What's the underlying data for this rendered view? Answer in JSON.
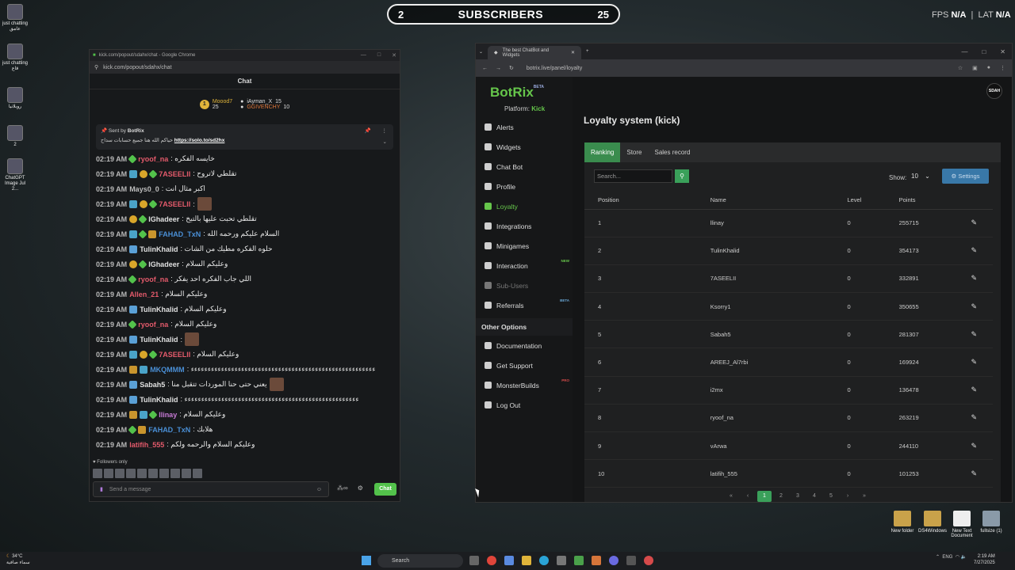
{
  "overlay": {
    "sub_left": "2",
    "sub_title": "SUBSCRIBERS",
    "sub_right": "25",
    "fps_label": "FPS",
    "fps_value": "N/A",
    "lat_label": "LAT",
    "lat_value": "N/A"
  },
  "desktop_left": [
    {
      "label": "just chatting عامق"
    },
    {
      "label": "just chatting قاع"
    },
    {
      "label": "روبلانيا"
    },
    {
      "label": "2"
    },
    {
      "label": "ChatGPT Image Jul 2..."
    }
  ],
  "desktop_right": [
    {
      "label": "New folder"
    },
    {
      "label": "DS4Windows"
    },
    {
      "label": "New Text Document"
    },
    {
      "label": "fullsize (1)"
    }
  ],
  "chat_window": {
    "title": "kick.com/popout/sdahx/chat - Google Chrome",
    "url": "kick.com/popout/sdahx/chat",
    "header": "Chat",
    "gifters": [
      {
        "name": "Moood7",
        "count": "25"
      },
      {
        "name": "iAyman_X",
        "count": "15"
      },
      {
        "name": "GGIVENCHY",
        "count": "10"
      }
    ],
    "pinned": {
      "sent_by": "Sent by",
      "bot": "BotRix",
      "text": "حياكم الله هنا جميع حسابات سداح",
      "link": "https://solo.to/sd2hx"
    },
    "messages": [
      {
        "time": "02:19 AM",
        "user": "ryoof_na",
        "color": "#e35a6b",
        "text": ": خايسه الفكره",
        "badges": [
          "vip"
        ]
      },
      {
        "time": "02:19 AM",
        "user": "7ASEELII",
        "color": "#e35a6b",
        "text": ": تقلطي لاتروح",
        "badges": [
          "sub",
          "gift",
          "vip"
        ]
      },
      {
        "time": "02:19 AM",
        "user": "Mays0_0",
        "color": "#bdbdbd",
        "text": ": اكبر مثال انت",
        "badges": []
      },
      {
        "time": "02:19 AM",
        "user": "7ASEELII",
        "color": "#e35a6b",
        "text": ":",
        "badges": [
          "sub",
          "gift",
          "vip"
        ],
        "emote": true
      },
      {
        "time": "02:19 AM",
        "user": "IGhadeer",
        "color": "#e0e0e0",
        "text": ": تقلطي تحبت عليها بالتيخ",
        "badges": [
          "gift",
          "vip"
        ]
      },
      {
        "time": "02:19 AM",
        "user": "FAHAD_TxN",
        "color": "#4a8fd6",
        "text": ": السلام عليكم ورحمه الله",
        "badges": [
          "sub",
          "vip",
          "og"
        ]
      },
      {
        "time": "02:19 AM",
        "user": "TulinKhalid",
        "color": "#e0e0e0",
        "text": ": حلوه الفكره مطيك من الشات",
        "badges": [
          "bot"
        ]
      },
      {
        "time": "02:19 AM",
        "user": "IGhadeer",
        "color": "#e0e0e0",
        "text": ": وعليكم السلام",
        "badges": [
          "gift",
          "vip"
        ]
      },
      {
        "time": "02:19 AM",
        "user": "ryoof_na",
        "color": "#e35a6b",
        "text": ": اللي جاب الفكره احد يفكر",
        "badges": [
          "vip"
        ]
      },
      {
        "time": "02:19 AM",
        "user": "Allen_21",
        "color": "#e35a6b",
        "text": ": وعليكم السلام",
        "badges": []
      },
      {
        "time": "02:19 AM",
        "user": "TulinKhalid",
        "color": "#e0e0e0",
        "text": ": وعليكم السلام",
        "badges": [
          "bot"
        ]
      },
      {
        "time": "02:19 AM",
        "user": "ryoof_na",
        "color": "#e35a6b",
        "text": ": وعليكم السلام",
        "badges": [
          "vip"
        ]
      },
      {
        "time": "02:19 AM",
        "user": "TulinKhalid",
        "color": "#e0e0e0",
        "text": ":",
        "badges": [
          "bot"
        ],
        "emote": true
      },
      {
        "time": "02:19 AM",
        "user": "7ASEELII",
        "color": "#e35a6b",
        "text": ": وعليكم السلام",
        "badges": [
          "sub",
          "gift",
          "vip"
        ]
      },
      {
        "time": "02:19 AM",
        "user": "MKQMMM",
        "color": "#4a8fd6",
        "text": ": ﺀﺀﺀﺀﺀﺀﺀﺀﺀﺀﺀﺀﺀﺀﺀﺀﺀﺀﺀﺀﺀﺀﺀﺀﺀﺀﺀﺀﺀﺀﺀﺀﺀﺀﺀﺀﺀﺀﺀﺀﺀﺀﺀﺀﺀﺀﺀﺀﺀﺀﺀﺀﺀﺀﺀ",
        "badges": [
          "og",
          "sub"
        ]
      },
      {
        "time": "02:19 AM",
        "user": "Sabah5",
        "color": "#e0e0e0",
        "text": ": يعني حتى حنا الموردات تتقبل منا",
        "badges": [
          "bot"
        ],
        "emote": true
      },
      {
        "time": "02:19 AM",
        "user": "TulinKhalid",
        "color": "#e0e0e0",
        "text": ": ﺀﺀﺀﺀﺀﺀﺀﺀﺀﺀﺀﺀﺀﺀﺀﺀﺀﺀﺀﺀﺀﺀﺀﺀﺀﺀﺀﺀﺀﺀﺀﺀﺀﺀﺀﺀﺀﺀﺀﺀﺀﺀﺀﺀﺀﺀﺀﺀﺀﺀﺀﺀ",
        "badges": [
          "bot"
        ]
      },
      {
        "time": "02:19 AM",
        "user": "llinay",
        "color": "#c77ad6",
        "text": ": وعليكم السلام",
        "badges": [
          "og",
          "sub",
          "vip"
        ]
      },
      {
        "time": "02:19 AM",
        "user": "FAHAD_TxN",
        "color": "#4a8fd6",
        "text": ": هلابك",
        "badges": [
          "vip",
          "og"
        ]
      },
      {
        "time": "02:19 AM",
        "user": "latifih_555",
        "color": "#e35a6b",
        "text": ": وعليكم السلام والرحمه ولكم",
        "badges": []
      }
    ],
    "followers_only": "Followers only",
    "input_placeholder": "Send a message",
    "send_label": "Chat"
  },
  "bot_window": {
    "tab_title": "The best ChatBot and Widgets",
    "url": "botrix.live/panel/loyalty",
    "logo": "BotRix",
    "logo_tag": "BETA",
    "platform_label": "Platform:",
    "platform_value": "Kick",
    "nav": [
      {
        "label": "Alerts",
        "state": ""
      },
      {
        "label": "Widgets",
        "state": ""
      },
      {
        "label": "Chat Bot",
        "state": ""
      },
      {
        "label": "Profile",
        "state": ""
      },
      {
        "label": "Loyalty",
        "state": "active"
      },
      {
        "label": "Integrations",
        "state": ""
      },
      {
        "label": "Minigames",
        "state": ""
      },
      {
        "label": "Interaction",
        "state": "",
        "tag": "NEW",
        "tag_color": "#66c64b"
      },
      {
        "label": "Sub-Users",
        "state": "dim"
      },
      {
        "label": "Referrals",
        "state": "",
        "tag": "BETA",
        "tag_color": "#6aa8d6"
      }
    ],
    "other_heading": "Other Options",
    "other_nav": [
      {
        "label": "Documentation"
      },
      {
        "label": "Get Support"
      },
      {
        "label": "MonsterBuilds",
        "tag": "PRO",
        "tag_color": "#d64a4a"
      },
      {
        "label": "Log Out"
      }
    ],
    "avatar_text": "SDAH",
    "page_title": "Loyalty system (kick)",
    "tabs": [
      "Ranking",
      "Store",
      "Sales record"
    ],
    "search_placeholder": "Search...",
    "show_label": "Show:",
    "show_value": "10",
    "settings_label": "Settings",
    "columns": [
      "Position",
      "Name",
      "Level",
      "Points"
    ],
    "rows": [
      {
        "pos": "1",
        "name": "llinay",
        "level": "0",
        "points": "255715"
      },
      {
        "pos": "2",
        "name": "TulinKhalid",
        "level": "0",
        "points": "354173"
      },
      {
        "pos": "3",
        "name": "7ASEELII",
        "level": "0",
        "points": "332891"
      },
      {
        "pos": "4",
        "name": "Ksorry1",
        "level": "0",
        "points": "350655"
      },
      {
        "pos": "5",
        "name": "Sabah5",
        "level": "0",
        "points": "281307"
      },
      {
        "pos": "6",
        "name": "AREEJ_Al7rbi",
        "level": "0",
        "points": "169924"
      },
      {
        "pos": "7",
        "name": "i2mx",
        "level": "0",
        "points": "136478"
      },
      {
        "pos": "8",
        "name": "ryoof_na",
        "level": "0",
        "points": "263219"
      },
      {
        "pos": "9",
        "name": "vArwa",
        "level": "0",
        "points": "244110"
      },
      {
        "pos": "10",
        "name": "latifih_555",
        "level": "0",
        "points": "101253"
      }
    ],
    "pages": [
      "«",
      "‹",
      "1",
      "2",
      "3",
      "4",
      "5",
      "›",
      "»"
    ],
    "current_page": "1"
  },
  "taskbar": {
    "weather_temp": "34°C",
    "weather_desc": "سماء صافية",
    "search_label": "Search",
    "lang": "ENG",
    "time": "2:19 AM",
    "date": "7/27/2025"
  }
}
